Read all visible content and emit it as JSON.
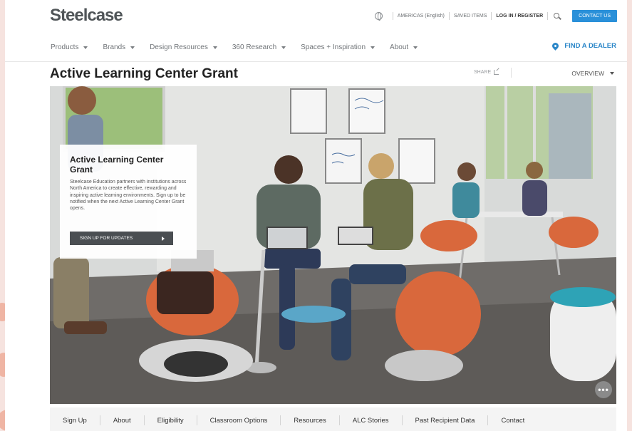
{
  "header": {
    "logo": "Steelcase",
    "region": "AMERICAS (English)",
    "saved_items": "SAVED ITEMS",
    "login": "LOG IN / REGISTER",
    "contact": "CONTACT US"
  },
  "nav": {
    "items": [
      "Products",
      "Brands",
      "Design Resources",
      "360 Research",
      "Spaces + Inspiration",
      "About"
    ],
    "dealer": "FIND A DEALER"
  },
  "page": {
    "title": "Active Learning Center Grant",
    "share": "SHARE",
    "overview": "OVERVIEW"
  },
  "promo": {
    "heading": "Active Learning Center Grant",
    "body": "Steelcase Education partners with institutions across North America to create effective, rewarding and inspiring active learning environments. Sign up to be notified when the next Active Learning Center Grant opens.",
    "button": "SIGN UP FOR UPDATES"
  },
  "more_button": "•••",
  "subnav": {
    "items": [
      "Sign Up",
      "About",
      "Eligibility",
      "Classroom Options",
      "Resources",
      "ALC Stories",
      "Past Recipient Data",
      "Contact"
    ]
  },
  "colors": {
    "accent": "#2a90d9",
    "dealer": "#2a86c8",
    "chair_orange": "#d9683c",
    "background": "#f6e3df"
  },
  "icons": [
    "globe-icon",
    "search-icon",
    "map-pin-icon",
    "share-icon",
    "chevron-down-icon",
    "arrow-right-icon",
    "more-icon"
  ]
}
